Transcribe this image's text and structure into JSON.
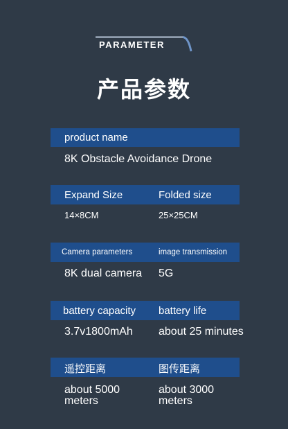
{
  "header": {
    "badge": "PARAMETER",
    "title": "产品参数"
  },
  "rows": [
    {
      "label": "product name",
      "value": "8K Obstacle Avoidance Drone"
    },
    {
      "label_left": "Expand Size",
      "label_right": "Folded size",
      "value_left": "14×8CM",
      "value_right": "25×25CM"
    },
    {
      "label_left": "Camera parameters",
      "label_right": "image transmission",
      "value_left": "8K dual camera",
      "value_right": "5G"
    },
    {
      "label_left": "battery capacity",
      "label_right": "battery life",
      "value_left": "3.7v1800mAh",
      "value_right": "about 25 minutes"
    },
    {
      "label_left": "遥控距离",
      "label_right": "图传距离",
      "value_left": "about 5000\nmeters",
      "value_right": "about 3000\nmeters"
    }
  ],
  "colors": {
    "background": "#2f3a47",
    "band": "#1f4e8c",
    "text": "#ffffff"
  }
}
